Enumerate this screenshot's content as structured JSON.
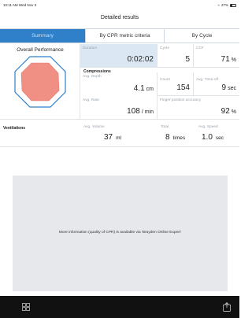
{
  "status_bar": {
    "time_date": "10:11 AM  Wed Nov 3",
    "battery": "27%",
    "battery_level": 0.27
  },
  "header": {
    "title": "Detailed results"
  },
  "tabs": [
    {
      "label": "Summary",
      "active": true
    },
    {
      "label": "By CPR metric criteria",
      "active": false
    },
    {
      "label": "By Cycle",
      "active": false
    }
  ],
  "overall": {
    "title": "Overall Performance",
    "shape_color": "#f08f84",
    "outline_color": "#2f80c8"
  },
  "summary": {
    "duration": {
      "label": "Duration",
      "value": "0:02:02"
    },
    "cycle": {
      "label": "Cycle",
      "value": "5"
    },
    "ccf": {
      "label": "CCF",
      "value": "71",
      "unit": "%"
    }
  },
  "compressions": {
    "title": "Compressions",
    "avg_depth": {
      "label": "Avg. Depth",
      "value": "4.1",
      "unit": "cm"
    },
    "count": {
      "label": "Count",
      "value": "154"
    },
    "avg_timeoff": {
      "label": "Avg. Time-off",
      "value": "9",
      "unit": "sec"
    },
    "avg_rate": {
      "label": "Avg. Rate",
      "value": "108",
      "unit": "/ min"
    },
    "finger_accuracy": {
      "label": "Finger position accuracy",
      "value": "92",
      "unit": "%"
    }
  },
  "ventilations": {
    "title": "Ventilations",
    "avg_volume": {
      "label": "Avg. Volume",
      "value": "37",
      "unit": "ml"
    },
    "total": {
      "label": "Total",
      "value": "8",
      "unit": "times"
    },
    "avg_speed": {
      "label": "Avg. Speed",
      "value": "1.0",
      "unit": "sec"
    }
  },
  "info": {
    "text": "More information (quality of CPR) is available via 'Brayden Online Expert'"
  },
  "bottom_bar": {
    "left_icon": "grid-icon",
    "right_icon": "export-icon"
  }
}
